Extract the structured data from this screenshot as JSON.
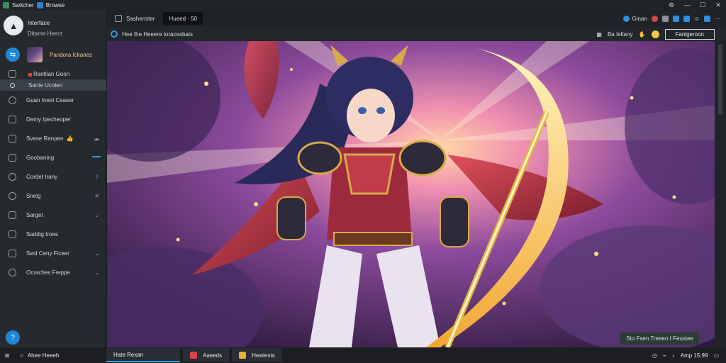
{
  "titlebar": {
    "app_name": "Switcher",
    "tab_name": "Browse",
    "controls": [
      "minimize",
      "maximize",
      "close"
    ]
  },
  "sidebar": {
    "profile_title": "Interface",
    "profile_subtitle": "Ditame Heect",
    "account_name": "Pandora Ickanes",
    "items": [
      {
        "label": "Rantlian Goon",
        "icon": "image-icon"
      },
      {
        "label": "Sante Ucolen",
        "icon": "circle-icon",
        "active": true
      },
      {
        "label": "Guan Ineel Ceaser",
        "icon": "chat-icon"
      },
      {
        "label": "Demy Ipecheoper",
        "icon": "doc-icon"
      },
      {
        "label": "Svese Renpen",
        "icon": "list-icon",
        "emoji": "👍"
      },
      {
        "label": "Goobaning",
        "icon": "folder-icon"
      },
      {
        "label": "Cordet Irany",
        "icon": "globe-icon"
      },
      {
        "label": "Snelg",
        "icon": "clock-icon"
      },
      {
        "label": "Sarget",
        "icon": "card-icon"
      },
      {
        "label": "Saddig Iroes",
        "icon": "table-icon"
      },
      {
        "label": "Swd Ceny Ficeer",
        "icon": "grid-icon"
      },
      {
        "label": "Ocraches Freppe",
        "icon": "gear-icon"
      }
    ],
    "help_label": "?"
  },
  "toolbar": {
    "tabs": [
      {
        "label": "Sashenster"
      },
      {
        "label": "Hueed · 50",
        "active": true
      }
    ],
    "right_label": "Ginan"
  },
  "infobar": {
    "path": "Hee Ihe Heeere toracesbats",
    "right_label": "Ba Ieltany",
    "button_label": "Fanlgeroon"
  },
  "canvas": {
    "overlay_label": "Sto Fsen Treeen I Feustee"
  },
  "taskbar": {
    "search_label": "Ahee Heeeh",
    "tasks": [
      {
        "label": "Hate Rexan",
        "active": true
      },
      {
        "label": "Aaeeds"
      },
      {
        "label": "Hewiests"
      }
    ],
    "clock": "Amp 15:99"
  }
}
